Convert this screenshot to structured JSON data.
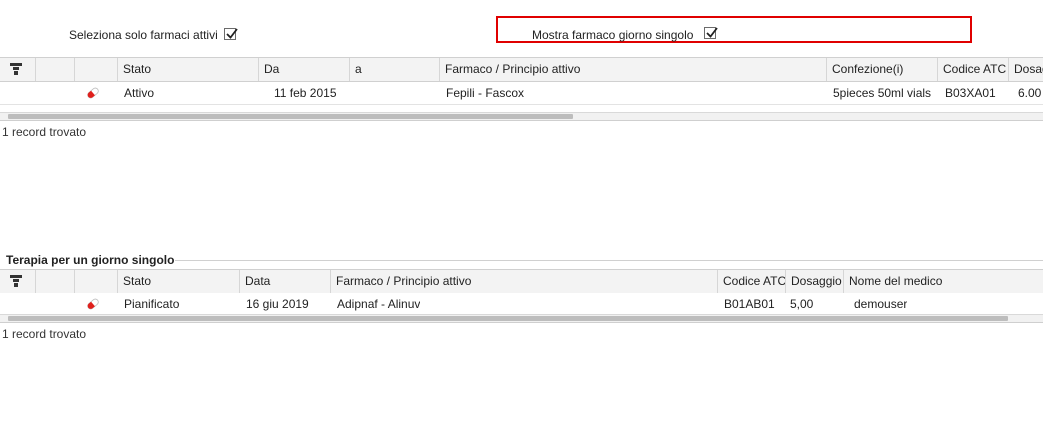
{
  "filters": {
    "active_only_label": "Seleziona solo farmaci attivi",
    "single_day_label": "Mostra farmaco giorno singolo",
    "active_only_checked": true,
    "single_day_checked": true,
    "highlight_color": "#e00000"
  },
  "therapy_table": {
    "columns": [
      "",
      "",
      "Stato",
      "Da",
      "a",
      "Farmaco / Principio attivo",
      "Confezione(i)",
      "Codice ATC",
      "Dosag"
    ],
    "rows": [
      {
        "icon": "pill-icon",
        "stato": "Attivo",
        "da": "11 feb 2015",
        "a": "",
        "farmaco": "Fepili - Fascox",
        "confezione": "5pieces 50ml vials",
        "atc": "B03XA01",
        "dosaggio": "6.00"
      }
    ],
    "record_count": "1 record trovato"
  },
  "single_day": {
    "title": "Terapia per un giorno singolo",
    "columns": [
      "",
      "",
      "Stato",
      "Data",
      "Farmaco / Principio attivo",
      "Codice ATC",
      "Dosaggio",
      "Nome del medico"
    ],
    "rows": [
      {
        "icon": "pill-icon",
        "stato": "Pianificato",
        "data": "16 giu 2019",
        "farmaco": "Adipnaf - Alinuv",
        "atc": "B01AB01",
        "dosaggio": "5,00",
        "medico": "demouser"
      }
    ],
    "record_count": "1 record trovato"
  },
  "colors": {
    "pill_red": "#e0201c",
    "header_bg": "#f3f3f3"
  }
}
